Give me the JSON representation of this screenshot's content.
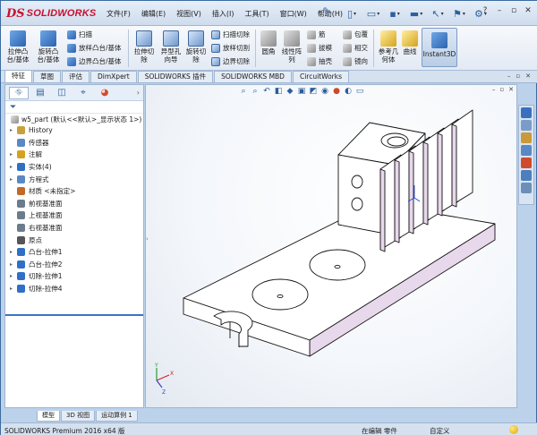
{
  "app": {
    "logo_mark": "DS",
    "logo_text": "SOLIDWORKS"
  },
  "menu": [
    "文件(F)",
    "编辑(E)",
    "视图(V)",
    "插入(I)",
    "工具(T)",
    "窗口(W)",
    "帮助(H)"
  ],
  "ribbon": {
    "extrude_boss": "拉伸凸\n台/基体",
    "revolve_boss": "旋转凸\n台/基体",
    "sweep": "扫描",
    "loft": "放样凸台/基体",
    "boundary_boss": "边界凸台/基体",
    "extrude_cut": "拉伸切\n除",
    "hole_wizard": "异型孔\n向导",
    "revolve_cut": "旋转切\n除",
    "swept_cut": "扫描切除",
    "lofted_cut": "放样切割",
    "boundary_cut": "边界切除",
    "fillet": "圆角",
    "linear_pattern": "线性阵\n列",
    "rib": "筋",
    "draft": "拔模",
    "shell": "抽壳",
    "wrap": "包覆",
    "intersect": "相交",
    "mirror": "镜向",
    "ref_geometry": "参考几\n何体",
    "curves": "曲线",
    "instant3d": "Instant3D"
  },
  "tabs": [
    "特征",
    "草图",
    "评估",
    "DimXpert",
    "SOLIDWORKS 插件",
    "SOLIDWORKS MBD",
    "CircuitWorks"
  ],
  "tree": {
    "part_title": "w5_part  (默认<<默认>_显示状态 1>)",
    "items": [
      {
        "label": "History",
        "exp": true
      },
      {
        "label": "传感器",
        "exp": false
      },
      {
        "label": "注解",
        "exp": true
      },
      {
        "label": "实体(4)",
        "exp": true
      },
      {
        "label": "方程式",
        "exp": true
      },
      {
        "label": "材质 <未指定>",
        "exp": false
      },
      {
        "label": "前视基准面",
        "exp": false
      },
      {
        "label": "上视基准面",
        "exp": false
      },
      {
        "label": "右视基准面",
        "exp": false
      },
      {
        "label": "原点",
        "exp": false
      },
      {
        "label": "凸台-拉伸1",
        "exp": true
      },
      {
        "label": "凸台-拉伸2",
        "exp": true
      },
      {
        "label": "切除-拉伸1",
        "exp": true
      },
      {
        "label": "切除-拉伸4",
        "exp": true
      }
    ]
  },
  "bottom_tabs": [
    "模型",
    "3D 视图",
    "运动算例 1"
  ],
  "status": {
    "app_version": "SOLIDWORKS Premium 2016 x64 版",
    "mode": "在编辑 零件",
    "units": "自定义"
  },
  "colors": {
    "accent": "#3b73c4",
    "brand_red": "#c8102e",
    "model_face": "#ffffff",
    "model_side": "#e6d6ea"
  }
}
